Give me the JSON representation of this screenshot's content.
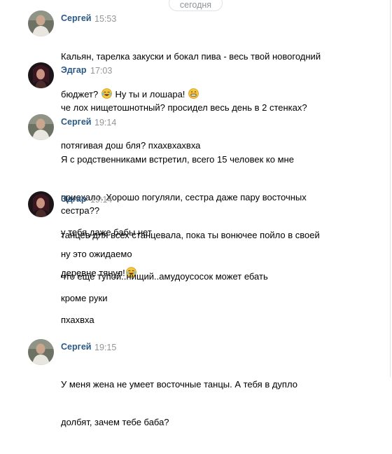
{
  "date_separator": "сегодня",
  "messages": [
    {
      "author": "Сергей",
      "time": "15:53",
      "lines": [
        "Кальян, тарелка закуски и бокал пива - весь твой новогодний",
        "бюджет?",
        "Ну ты и лошара!"
      ],
      "emoji": [
        "laughing-tears-emoji",
        "grinning-emoji"
      ]
    },
    {
      "author": "Эдгар",
      "time": "17:03",
      "lines": [
        "че лох нищетошнотный? просидел весь день в 2 стенках?",
        "потягивая дош бля? пхахвхахвха"
      ]
    },
    {
      "author": "Сергей",
      "time": "19:14",
      "lines": [
        "Я с родственниками встретил, всего 15 человек ко мне",
        "приехало. Хорошо погуляли, сестра даже пару восточных",
        "танцев для всех станцевала, пока ты вонючее пойло в своей",
        "деревне тянул!"
      ],
      "emoji": [
        "laughing-tears-emoji"
      ]
    },
    {
      "author": "Эдгар",
      "time": "19:14",
      "lines": [
        "сестра??",
        "у тебя даже бабы нет",
        "ну это ожидаемо",
        "что еще тупой..нищий..амудоусосок может ебать",
        "кроме руки",
        "пхахвха"
      ]
    },
    {
      "author": "Сергей",
      "time": "19:15",
      "lines": [
        "У меня жена не умеет восточные танцы. А тебя в дупло",
        "долбят, зачем тебе баба?"
      ]
    }
  ]
}
